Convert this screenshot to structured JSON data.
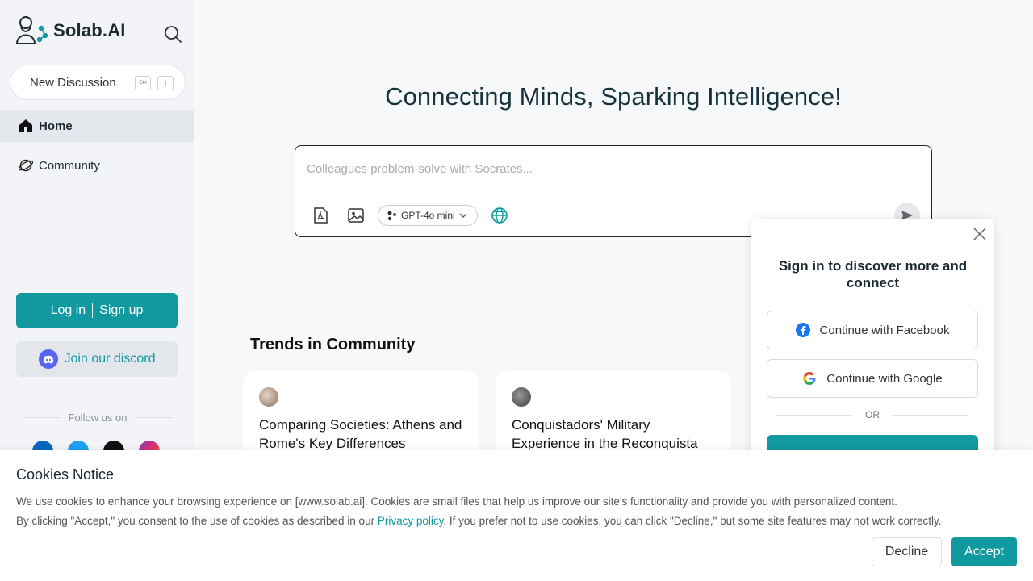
{
  "sidebar": {
    "logo_text": "Solab.AI",
    "new_discussion_label": "New Discussion",
    "shortcut_keys": [
      "Ctrl",
      "I"
    ],
    "nav": [
      {
        "label": "Home",
        "icon": "home-icon",
        "active": true
      },
      {
        "label": "Community",
        "icon": "planet-icon",
        "active": false
      }
    ],
    "login_label": "Log in",
    "signup_label": "Sign up",
    "discord_label": "Join our discord",
    "follow_label": "Follow us on",
    "socials": [
      "linkedin-icon",
      "twitter-icon",
      "x-icon",
      "instagram-icon"
    ]
  },
  "main": {
    "headline": "Connecting Minds, Sparking Intelligence!",
    "composer": {
      "placeholder": "Colleagues problem-solve with Socrates...",
      "model": "GPT-4o mini"
    },
    "trends_title": "Trends in Community",
    "cards": [
      {
        "title": "Comparing Societies: Athens and Rome's Key Differences"
      },
      {
        "title": "Conquistadors' Military Experience in the Reconquista"
      }
    ]
  },
  "signin_popup": {
    "title": "Sign in to discover more and connect",
    "facebook_label": "Continue with Facebook",
    "google_label": "Continue with Google",
    "or_label": "OR"
  },
  "cookies": {
    "title": "Cookies Notice",
    "line1": "We use cookies to enhance your browsing experience on [www.solab.ai]. Cookies are small files that help us improve our site's functionality and provide you with personalized content.",
    "line2_before": "By clicking \"Accept,\" you consent to the use of cookies as described in our ",
    "privacy_link": "Privacy policy",
    "line2_after": ". If you prefer not to use cookies, you can click \"Decline,\" but some site features may not work correctly.",
    "decline_label": "Decline",
    "accept_label": "Accept"
  },
  "colors": {
    "accent": "#10999f",
    "discord": "#5865f2"
  }
}
